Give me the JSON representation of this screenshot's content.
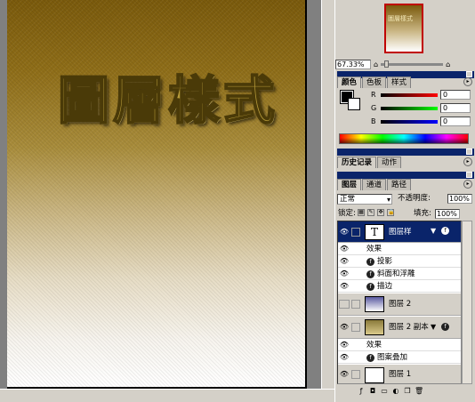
{
  "canvas": {
    "title": "圖層樣式"
  },
  "navigator": {
    "preview_text": "圖層樣式",
    "zoom": "67.33%"
  },
  "color_panel": {
    "tabs": [
      "颜色",
      "色板",
      "样式"
    ],
    "channels": [
      {
        "label": "R",
        "value": "0"
      },
      {
        "label": "G",
        "value": "0"
      },
      {
        "label": "B",
        "value": "0"
      }
    ],
    "foreground": "#000000",
    "background": "#ffffff"
  },
  "history_panel": {
    "tabs": [
      "历史记录",
      "动作"
    ]
  },
  "layers_panel": {
    "tabs": [
      "图层",
      "通道",
      "路径"
    ],
    "blend_mode": "正常",
    "opacity_label": "不透明度:",
    "opacity_value": "100%",
    "lock_label": "锁定:",
    "fill_label": "填充:",
    "fill_value": "100%",
    "layers": [
      {
        "name": "图层样",
        "type": "text",
        "thumb": "T",
        "selected": true
      },
      {
        "name": "效果",
        "type": "fx-header"
      },
      {
        "name": "投影",
        "type": "fx"
      },
      {
        "name": "斜面和浮雕",
        "type": "fx"
      },
      {
        "name": "描边",
        "type": "fx"
      },
      {
        "name": "图层 2",
        "type": "layer"
      },
      {
        "name": "图层 2 副本",
        "type": "layer"
      },
      {
        "name": "效果",
        "type": "fx-header"
      },
      {
        "name": "图案叠加",
        "type": "fx"
      },
      {
        "name": "图层 1",
        "type": "layer"
      }
    ]
  }
}
